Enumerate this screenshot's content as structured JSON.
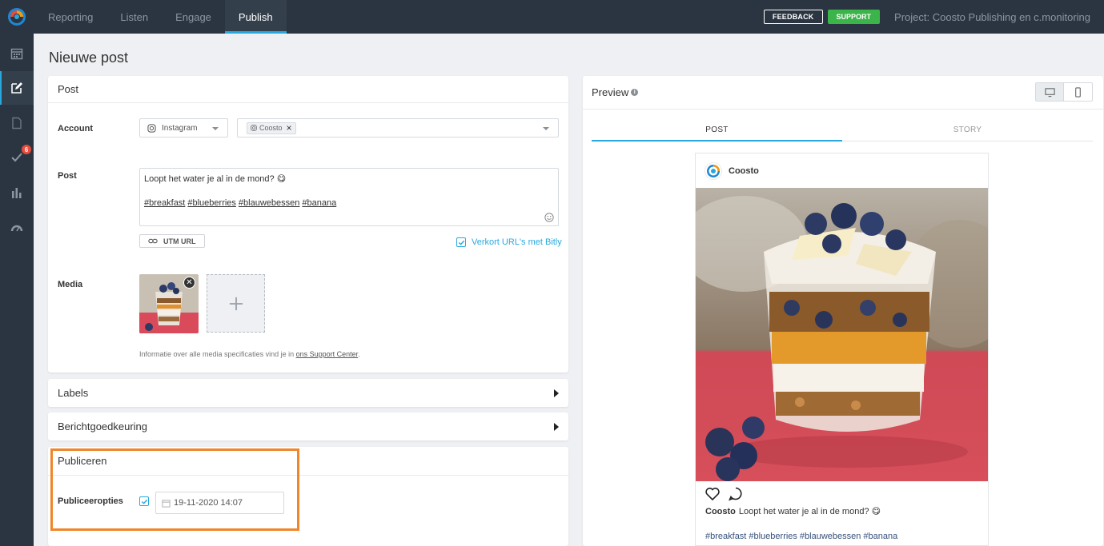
{
  "nav": {
    "items": [
      {
        "label": "Reporting",
        "active": false
      },
      {
        "label": "Listen",
        "active": false
      },
      {
        "label": "Engage",
        "active": false
      },
      {
        "label": "Publish",
        "active": true
      }
    ],
    "feedback_label": "FEEDBACK",
    "support_label": "SUPPORT",
    "project": "Project: Coosto Publishing en c.monitoring"
  },
  "sidebar": {
    "items": [
      {
        "icon": "calendar-icon"
      },
      {
        "icon": "compose-icon",
        "active": true
      },
      {
        "icon": "document-icon"
      },
      {
        "icon": "check-icon",
        "badge": "6"
      },
      {
        "icon": "bar-chart-icon"
      },
      {
        "icon": "gauge-icon"
      }
    ]
  },
  "page": {
    "title": "Nieuwe post"
  },
  "post_card": {
    "title": "Post",
    "account_label": "Account",
    "network_value": "Instagram",
    "account_tag": "Coosto",
    "post_label": "Post",
    "post_text": "Loopt het water je al in de mond? 😋",
    "hashtags": [
      "#breakfast",
      "#blueberries",
      "#blauwebessen",
      "#banana"
    ],
    "utm_label": "UTM URL",
    "bitly_label": "Verkort URL's met Bitly",
    "bitly_checked": true,
    "media_label": "Media",
    "media_info_prefix": "Informatie over alle media specificaties vind je in ",
    "media_info_link": "ons Support Center",
    "media_info_suffix": "."
  },
  "labels_card": {
    "title": "Labels"
  },
  "approval_card": {
    "title": "Berichtgoedkeuring"
  },
  "publish_card": {
    "title": "Publiceren",
    "options_label": "Publiceeropties",
    "checked": true,
    "datetime": "19-11-2020 14:07"
  },
  "preview": {
    "title": "Preview",
    "tabs": [
      {
        "label": "POST",
        "active": true
      },
      {
        "label": "STORY",
        "active": false
      }
    ],
    "account_name": "Coosto",
    "caption_user": "Coosto",
    "caption_text": "Loopt het water je al in de mond? 😋",
    "hashtags": [
      "#breakfast",
      "#blueberries",
      "#blauwebessen",
      "#banana"
    ]
  },
  "colors": {
    "topbar": "#2b3541",
    "accent": "#29a8df",
    "support": "#3bb54a",
    "highlight": "#f0862b",
    "badge": "#e74c3c"
  }
}
